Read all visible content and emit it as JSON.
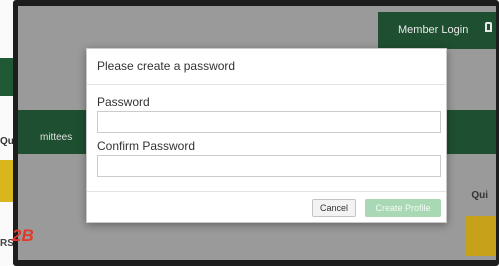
{
  "background_page": {
    "member_login_label": "Member Login",
    "left_strip_qui": "Qui",
    "left_strip_rss": "RSS",
    "nav_text": "mittees",
    "right_qui": "Qui"
  },
  "badge_label": "2B",
  "modal": {
    "title": "Please create a password",
    "password_label": "Password",
    "password_value": "",
    "confirm_label": "Confirm Password",
    "confirm_value": "",
    "cancel_label": "Cancel",
    "create_label": "Create Profile"
  },
  "colors": {
    "brand_green": "#1e4f31",
    "accent_yellow": "#d9b51e",
    "disabled_button": "#a9d8b4",
    "badge_red": "#e03a2a"
  }
}
